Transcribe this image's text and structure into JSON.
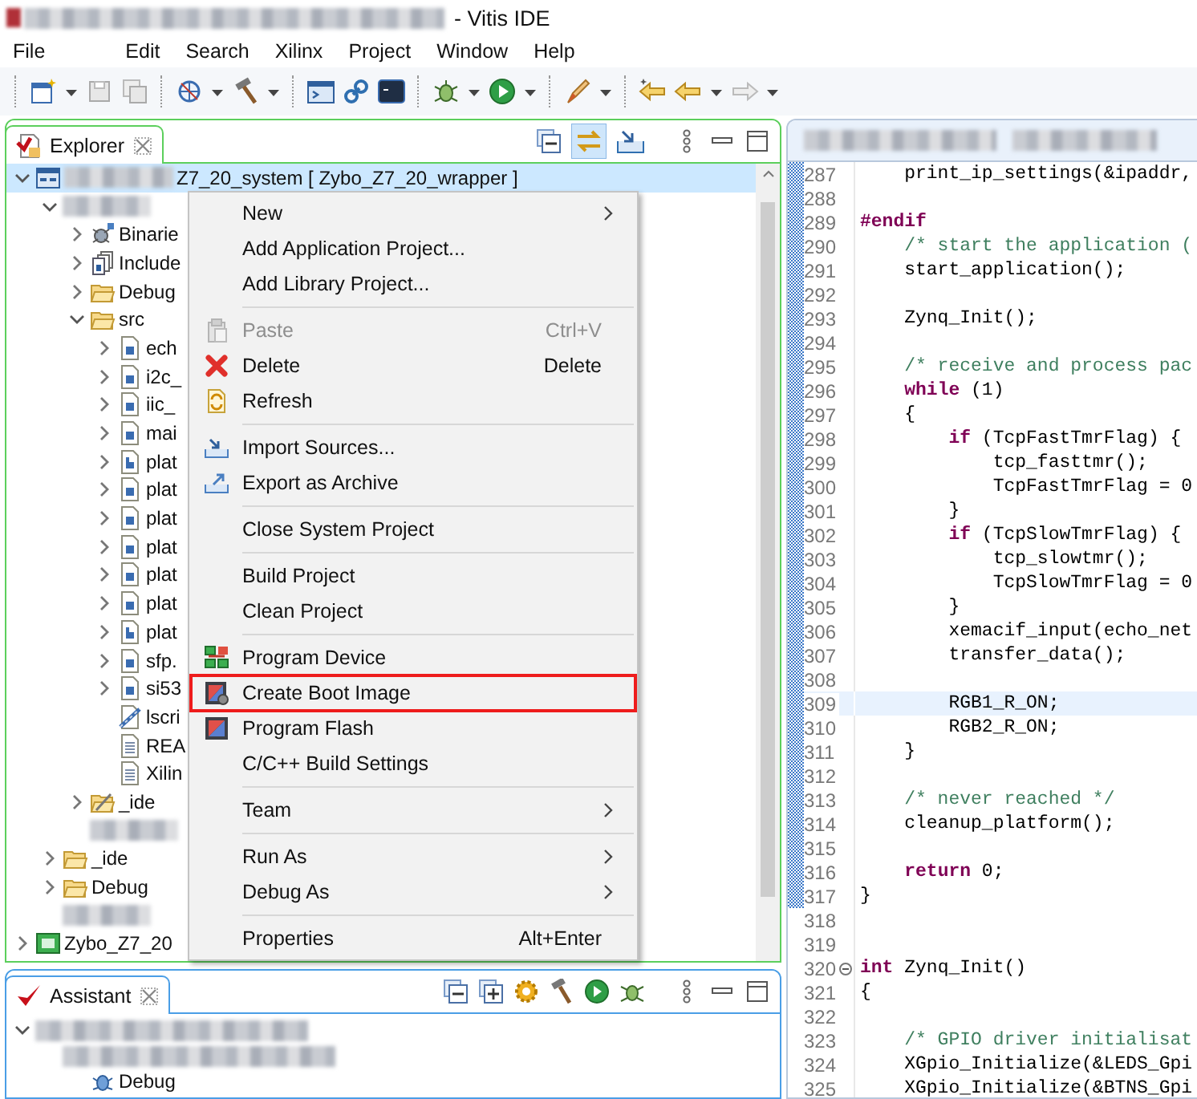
{
  "window": {
    "title": "- Vitis IDE"
  },
  "menu_bar": [
    "File",
    "Edit",
    "Search",
    "Xilinx",
    "Project",
    "Window",
    "Help"
  ],
  "explorer": {
    "tab": "Explorer",
    "tree": [
      {
        "blurred": true,
        "label": "Z7_20_system [ Zybo_Z7_20_wrapper ]",
        "kind": "project",
        "expanded": true,
        "selected": true,
        "children": [
          {
            "blurred": true,
            "expanded": true,
            "selected": false,
            "children": [
              {
                "label": "Binarie",
                "kind": "binaries",
                "expanded": false,
                "selected": false
              },
              {
                "label": "Include",
                "kind": "includes",
                "expanded": false,
                "selected": false
              },
              {
                "label": "Debug",
                "kind": "folder",
                "expanded": false,
                "selected": false
              },
              {
                "label": "src",
                "kind": "folder",
                "expanded": true,
                "selected": false,
                "children": [
                  {
                    "label": "ech",
                    "kind": "c-file",
                    "expanded": false,
                    "selected": false
                  },
                  {
                    "label": "i2c_",
                    "kind": "c-file",
                    "expanded": false,
                    "selected": false
                  },
                  {
                    "label": "iic_",
                    "kind": "c-file",
                    "expanded": false,
                    "selected": false
                  },
                  {
                    "label": "mai",
                    "kind": "c-file",
                    "expanded": false,
                    "selected": false
                  },
                  {
                    "label": "plat",
                    "kind": "h-file",
                    "expanded": false,
                    "selected": false
                  },
                  {
                    "label": "plat",
                    "kind": "c-file",
                    "expanded": false,
                    "selected": false
                  },
                  {
                    "label": "plat",
                    "kind": "c-file",
                    "expanded": false,
                    "selected": false
                  },
                  {
                    "label": "plat",
                    "kind": "c-file",
                    "expanded": false,
                    "selected": false
                  },
                  {
                    "label": "plat",
                    "kind": "c-file",
                    "expanded": false,
                    "selected": false
                  },
                  {
                    "label": "plat",
                    "kind": "c-file",
                    "expanded": false,
                    "selected": false
                  },
                  {
                    "label": "plat",
                    "kind": "h-file",
                    "expanded": false,
                    "selected": false
                  },
                  {
                    "label": "sfp.",
                    "kind": "c-file",
                    "expanded": false,
                    "selected": false
                  },
                  {
                    "label": "si53",
                    "kind": "c-file",
                    "expanded": false,
                    "selected": false
                  },
                  {
                    "label": "lscri",
                    "kind": "linker",
                    "selected": false
                  },
                  {
                    "label": "REA",
                    "kind": "text",
                    "selected": false
                  },
                  {
                    "label": "Xilin",
                    "kind": "text",
                    "selected": false
                  }
                ]
              },
              {
                "label": "_ide",
                "kind": "folder-settings",
                "expanded": false,
                "selected": false
              },
              {
                "blurred": true,
                "selected": false
              }
            ]
          },
          {
            "label": "_ide",
            "kind": "folder",
            "expanded": false,
            "selected": false
          },
          {
            "label": "Debug",
            "kind": "folder",
            "expanded": false,
            "selected": false
          },
          {
            "blurred": true,
            "selected": false
          }
        ]
      },
      {
        "label": "Zybo_Z7_20",
        "kind": "board",
        "expanded": false,
        "selected": false
      }
    ]
  },
  "context_menu": {
    "groups": [
      [
        {
          "label": "New",
          "submenu": true,
          "disabled": false
        },
        {
          "label": "Add Application Project...",
          "disabled": false
        },
        {
          "label": "Add Library Project...",
          "disabled": false
        }
      ],
      [
        {
          "label": "Paste",
          "shortcut": "Ctrl+V",
          "kind": "paste",
          "disabled": true
        },
        {
          "label": "Delete",
          "shortcut": "Delete",
          "kind": "delete",
          "disabled": false
        },
        {
          "label": "Refresh",
          "kind": "refresh",
          "disabled": false
        }
      ],
      [
        {
          "label": "Import Sources...",
          "kind": "import",
          "disabled": false
        },
        {
          "label": "Export as Archive",
          "kind": "export",
          "disabled": false
        }
      ],
      [
        {
          "label": "Close System Project",
          "disabled": false
        }
      ],
      [
        {
          "label": "Build Project",
          "disabled": false
        },
        {
          "label": "Clean Project",
          "disabled": false
        }
      ],
      [
        {
          "label": "Program Device",
          "kind": "program-device",
          "disabled": false
        },
        {
          "label": "Create Boot Image",
          "kind": "boot-image",
          "disabled": false,
          "annotated": true
        },
        {
          "label": "Program Flash",
          "kind": "flash",
          "disabled": false
        },
        {
          "label": "C/C++ Build Settings",
          "disabled": false
        }
      ],
      [
        {
          "label": "Team",
          "submenu": true,
          "disabled": false
        }
      ],
      [
        {
          "label": "Run As",
          "submenu": true,
          "disabled": false
        },
        {
          "label": "Debug As",
          "submenu": true,
          "disabled": false
        }
      ],
      [
        {
          "label": "Properties",
          "shortcut": "Alt+Enter",
          "disabled": false
        }
      ]
    ]
  },
  "editor": {
    "line_groups": [
      {
        "marked": true,
        "lines": [
          {
            "number": "287",
            "kind": "code",
            "code": "    print_ip_settings(&ipaddr,"
          },
          {
            "number": "288",
            "kind": "blank"
          },
          {
            "number": "289",
            "kind": "code",
            "code": "**#endif**"
          },
          {
            "number": "290",
            "kind": "comment",
            "code": "    /* start the application ("
          },
          {
            "number": "291",
            "kind": "code",
            "code": "    start_application();"
          },
          {
            "number": "292",
            "kind": "blank"
          },
          {
            "number": "293",
            "kind": "code",
            "code": "    Zynq_Init();"
          },
          {
            "number": "294",
            "kind": "blank"
          },
          {
            "number": "295",
            "kind": "comment",
            "code": "    /* receive and process pac"
          },
          {
            "number": "296",
            "kind": "code",
            "code": "    **while** (1)"
          },
          {
            "number": "297",
            "kind": "code",
            "code": "    {"
          },
          {
            "number": "298",
            "kind": "code",
            "code": "        **if** (TcpFastTmrFlag) {"
          },
          {
            "number": "299",
            "kind": "code",
            "code": "            tcp_fasttmr();"
          },
          {
            "number": "300",
            "kind": "code",
            "code": "            TcpFastTmrFlag = 0"
          },
          {
            "number": "301",
            "kind": "code",
            "code": "        }"
          },
          {
            "number": "302",
            "kind": "code",
            "code": "        **if** (TcpSlowTmrFlag) {"
          },
          {
            "number": "303",
            "kind": "code",
            "code": "            tcp_slowtmr();"
          },
          {
            "number": "304",
            "kind": "code",
            "code": "            TcpSlowTmrFlag = 0"
          },
          {
            "number": "305",
            "kind": "code",
            "code": "        }"
          },
          {
            "number": "306",
            "kind": "code",
            "code": "        xemacif_input(echo_net"
          },
          {
            "number": "307",
            "kind": "code",
            "code": "        transfer_data();"
          },
          {
            "number": "308",
            "kind": "blank"
          },
          {
            "number": "309",
            "kind": "code",
            "code": "        RGB1_R_ON;",
            "current": true
          },
          {
            "number": "310",
            "kind": "code",
            "code": "        RGB2_R_ON;"
          },
          {
            "number": "311",
            "kind": "code",
            "code": "    }"
          },
          {
            "number": "312",
            "kind": "blank"
          },
          {
            "number": "313",
            "kind": "comment",
            "code": "    /* never reached */"
          },
          {
            "number": "314",
            "kind": "code",
            "code": "    cleanup_platform();"
          },
          {
            "number": "315",
            "kind": "blank"
          },
          {
            "number": "316",
            "kind": "code",
            "code": "    **return** 0;"
          },
          {
            "number": "317",
            "kind": "code",
            "code": "}"
          }
        ]
      },
      {
        "marked": false,
        "lines": [
          {
            "number": "318",
            "kind": "blank"
          },
          {
            "number": "319",
            "kind": "blank"
          },
          {
            "number": "320",
            "kind": "code",
            "code": "**int** Zynq_Init()",
            "foldable": true
          },
          {
            "number": "321",
            "kind": "code",
            "code": "{"
          },
          {
            "number": "322",
            "kind": "blank"
          },
          {
            "number": "323",
            "kind": "comment",
            "code": "    /* GPIO driver initialisat"
          },
          {
            "number": "324",
            "kind": "code",
            "code": "    XGpio_Initialize(&LEDS_Gpi"
          },
          {
            "number": "325",
            "kind": "code",
            "code": "    XGpio_Initialize(&BTNS_Gpi"
          }
        ]
      }
    ]
  },
  "assistant": {
    "tab": "Assistant",
    "tree": [
      {
        "blurred": true,
        "expanded": true,
        "selected": false,
        "children": [
          {
            "blurred": true,
            "selected": false,
            "children": [
              {
                "label": "Debug",
                "kind": "debug-config",
                "selected": false
              }
            ]
          }
        ]
      }
    ]
  }
}
